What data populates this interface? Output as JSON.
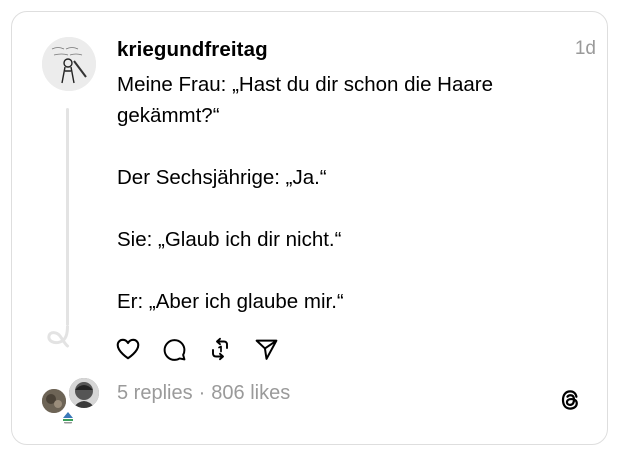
{
  "post": {
    "username": "kriegundfreitag",
    "time": "1d",
    "lines": [
      "Meine Frau: „Hast du dir schon die Haare gekämmt?“",
      "Der Sechsjährige: „Ja.“",
      "Sie: „Glaub ich dir nicht.“",
      "Er: „Aber ich glaube mir.“"
    ],
    "replies": "5 replies",
    "separator": "·",
    "likes": "806 likes"
  },
  "icons": {
    "like": "heart-icon",
    "reply": "comment-icon",
    "repost": "repost-icon",
    "share": "send-icon",
    "brand": "threads-logo-icon"
  },
  "colors": {
    "text": "#000000",
    "muted": "#9a9a9a",
    "border": "#dedede",
    "line": "#e3e3e3"
  }
}
